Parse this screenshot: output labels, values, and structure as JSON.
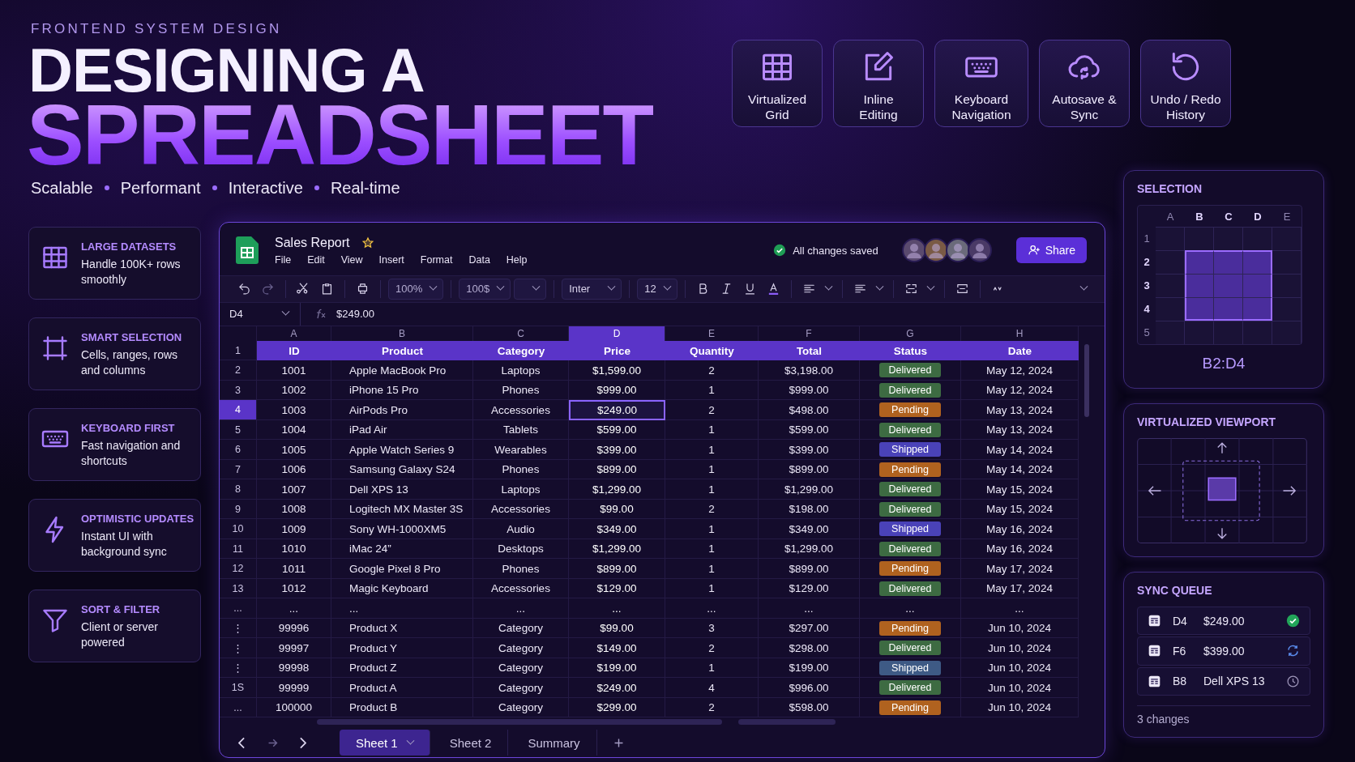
{
  "header": {
    "eyebrow": "FRONTEND SYSTEM DESIGN",
    "title_line_1": "DESIGNING A",
    "title_line_2": "SPREADSHEET",
    "taglines": [
      "Scalable",
      "Performant",
      "Interactive",
      "Real-time"
    ]
  },
  "feature_tiles": [
    {
      "lines": [
        "Virtualized",
        "Grid"
      ]
    },
    {
      "lines": [
        "Inline",
        "Editing"
      ]
    },
    {
      "lines": [
        "Keyboard",
        "Navigation"
      ]
    },
    {
      "lines": [
        "Autosave &",
        "Sync"
      ]
    },
    {
      "lines": [
        "Undo / Redo",
        "History"
      ]
    }
  ],
  "feature_cards": [
    {
      "title": "LARGE DATASETS",
      "description": "Handle 100K+ rows smoothly"
    },
    {
      "title": "SMART SELECTION",
      "description": "Cells, ranges, rows and columns"
    },
    {
      "title": "KEYBOARD FIRST",
      "description": "Fast navigation and shortcuts"
    },
    {
      "title": "OPTIMISTIC UPDATES",
      "description": "Instant UI with background sync"
    },
    {
      "title": "SORT & FILTER",
      "description": "Client or server powered"
    }
  ],
  "spreadsheet": {
    "title": "Sales Report",
    "starred": true,
    "menus": [
      "File",
      "Edit",
      "View",
      "Insert",
      "Format",
      "Data",
      "Help"
    ],
    "save_status": "All changes saved",
    "share_label": "Share",
    "toolbar": {
      "zoom": "100%",
      "number_format": "100$",
      "font": "Inter",
      "font_size": "12"
    },
    "name_box": "D4",
    "formula": "$249.00",
    "columns": [
      {
        "letter": "A",
        "selected": false
      },
      {
        "letter": "B",
        "selected": false
      },
      {
        "letter": "C",
        "selected": false
      },
      {
        "letter": "D",
        "selected": true
      },
      {
        "letter": "E",
        "selected": false
      },
      {
        "letter": "F",
        "selected": false
      },
      {
        "letter": "G",
        "selected": false
      },
      {
        "letter": "H",
        "selected": false
      }
    ],
    "header_row": {
      "number": "1",
      "cells": [
        "ID",
        "Product",
        "Category",
        "Price",
        "Quantity",
        "Total",
        "Status",
        "Date"
      ]
    },
    "rows": [
      {
        "number": "2",
        "selected": false,
        "cells": [
          "1001",
          "Apple MacBook Pro",
          "Laptops",
          "$1,599.00",
          "2",
          "$3,198.00",
          "Delivered",
          "May 12, 2024"
        ],
        "color": "#3d6b42"
      },
      {
        "number": "3",
        "selected": false,
        "cells": [
          "1002",
          "iPhone 15 Pro",
          "Phones",
          "$999.00",
          "1",
          "$999.00",
          "Delivered",
          "May 12, 2024"
        ],
        "color": "#3d6b42"
      },
      {
        "number": "4",
        "selected": true,
        "cells": [
          "1003",
          "AirPods Pro",
          "Accessories",
          "$249.00",
          "2",
          "$498.00",
          "Pending",
          "May 13, 2024"
        ],
        "color": "#b0621f"
      },
      {
        "number": "5",
        "selected": false,
        "cells": [
          "1004",
          "iPad Air",
          "Tablets",
          "$599.00",
          "1",
          "$599.00",
          "Delivered",
          "May 13, 2024"
        ],
        "color": "#3d6b42"
      },
      {
        "number": "6",
        "selected": false,
        "cells": [
          "1005",
          "Apple Watch  Series 9",
          "Wearables",
          "$399.00",
          "1",
          "$399.00",
          "Shipped",
          "May 14, 2024"
        ],
        "color": "#4a42b8"
      },
      {
        "number": "7",
        "selected": false,
        "cells": [
          "1006",
          "Samsung Galaxy S24",
          "Phones",
          "$899.00",
          "1",
          "$899.00",
          "Pending",
          "May 14, 2024"
        ],
        "color": "#b0621f"
      },
      {
        "number": "8",
        "selected": false,
        "cells": [
          "1007",
          "Dell XPS 13",
          "Laptops",
          "$1,299.00",
          "1",
          "$1,299.00",
          "Delivered",
          "May 15, 2024"
        ],
        "color": "#3d6b42"
      },
      {
        "number": "9",
        "selected": false,
        "cells": [
          "1008",
          "Logitech MX Master 3S",
          "Accessories",
          "$99.00",
          "2",
          "$198.00",
          "Delivered",
          "May 15, 2024"
        ],
        "color": "#3d6b42"
      },
      {
        "number": "10",
        "selected": false,
        "cells": [
          "1009",
          "Sony WH-1000XM5",
          "Audio",
          "$349.00",
          "1",
          "$349.00",
          "Shipped",
          "May 16, 2024"
        ],
        "color": "#4a42b8"
      },
      {
        "number": "11",
        "selected": false,
        "cells": [
          "1010",
          "iMac 24”",
          "Desktops",
          "$1,299.00",
          "1",
          "$1,299.00",
          "Delivered",
          "May 16, 2024"
        ],
        "color": "#3d6b42"
      },
      {
        "number": "12",
        "selected": false,
        "cells": [
          "1011",
          "Google Pixel 8 Pro",
          "Phones",
          "$899.00",
          "1",
          "$899.00",
          "Pending",
          "May 17, 2024"
        ],
        "color": "#b0621f"
      },
      {
        "number": "13",
        "selected": false,
        "cells": [
          "1012",
          "Magic Keyboard",
          "Accessories",
          "$129.00",
          "1",
          "$129.00",
          "Delivered",
          "May 17, 2024"
        ],
        "color": "#3d6b42"
      },
      {
        "number": "...",
        "selected": false,
        "cells": [
          "...",
          "...",
          "...",
          "...",
          "...",
          "...",
          "...",
          "..."
        ]
      },
      {
        "number": "⋮",
        "selected": false,
        "cells": [
          "99996",
          "Product X",
          "Category",
          "$99.00",
          "3",
          "$297.00",
          "Pending",
          "Jun 10, 2024"
        ],
        "color": "#b0621f"
      },
      {
        "number": "⋮",
        "selected": false,
        "cells": [
          "99997",
          "Product Y",
          "Category",
          "$149.00",
          "2",
          "$298.00",
          "Delivered",
          "Jun 10, 2024"
        ],
        "color": "#3d6b42"
      },
      {
        "number": "⋮",
        "selected": false,
        "cells": [
          "99998",
          "Product Z",
          "Category",
          "$199.00",
          "1",
          "$199.00",
          "Shipped",
          "Jun 10, 2024"
        ],
        "color": "#3e5a85"
      },
      {
        "number": "1S",
        "selected": false,
        "cells": [
          "99999",
          "Product A",
          "Category",
          "$249.00",
          "4",
          "$996.00",
          "Delivered",
          "Jun 10, 2024"
        ],
        "color": "#3d6b42"
      },
      {
        "number": "...",
        "selected": false,
        "cells": [
          "100000",
          "Product B",
          "Category",
          "$299.00",
          "2",
          "$598.00",
          "Pending",
          "Jun 10, 2024"
        ],
        "color": "#b0621f"
      }
    ],
    "sheet_tabs": [
      {
        "label": "Sheet 1",
        "selected": true
      },
      {
        "label": "Sheet 2",
        "selected": false
      },
      {
        "label": "Summary",
        "selected": false
      }
    ]
  },
  "selection_panel": {
    "title": "SELECTION",
    "columns": [
      {
        "label": "A",
        "selected": false
      },
      {
        "label": "B",
        "selected": true
      },
      {
        "label": "C",
        "selected": true
      },
      {
        "label": "D",
        "selected": true
      },
      {
        "label": "E",
        "selected": false
      }
    ],
    "rows": [
      {
        "label": "1",
        "selected": false
      },
      {
        "label": "2",
        "selected": true
      },
      {
        "label": "3",
        "selected": true
      },
      {
        "label": "4",
        "selected": true
      },
      {
        "label": "5",
        "selected": false
      }
    ],
    "range": "B2:D4"
  },
  "viewport_panel": {
    "title": "VIRTUALIZED VIEWPORT"
  },
  "sync_queue": {
    "title": "SYNC QUEUE",
    "items": [
      {
        "cell": "D4",
        "value": "$249.00",
        "kind": "synced"
      },
      {
        "cell": "F6",
        "value": "$399.00",
        "kind": "syncing"
      },
      {
        "cell": "B8",
        "value": "Dell XPS 13",
        "kind": "queued"
      }
    ],
    "footer": "3 changes"
  }
}
